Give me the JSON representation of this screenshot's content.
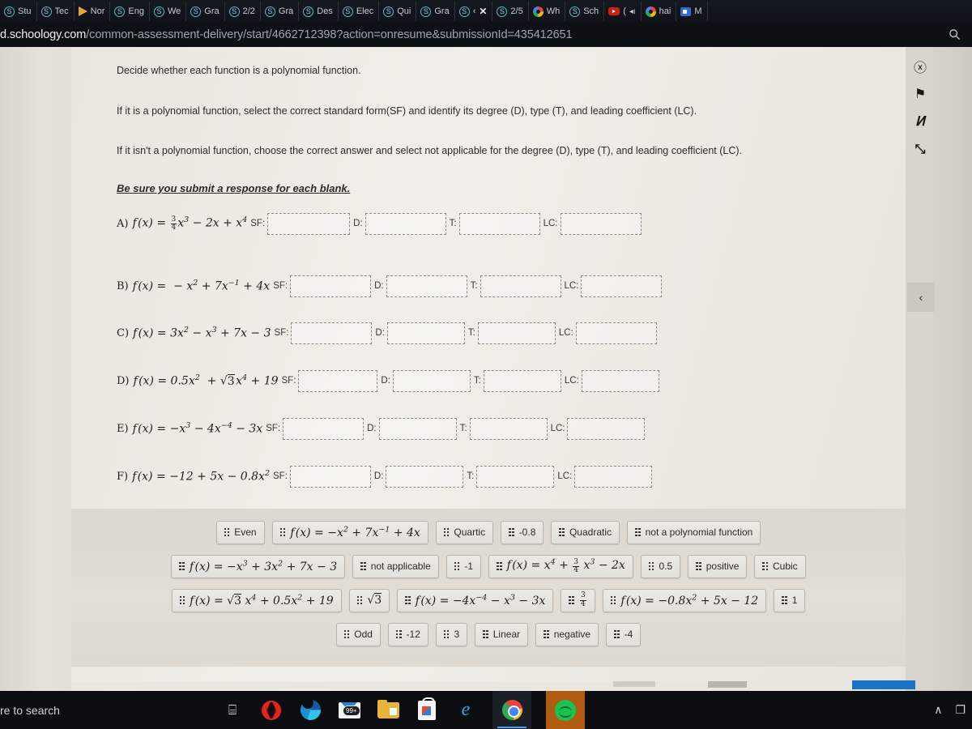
{
  "browser": {
    "tabs": [
      {
        "favicon": "favicon-generic",
        "label": "Stu"
      },
      {
        "favicon": "schoology-favicon",
        "label": "Tec"
      },
      {
        "favicon": "nearpod-favicon",
        "label": "Nor"
      },
      {
        "favicon": "schoology-favicon",
        "label": "Eng"
      },
      {
        "favicon": "schoology-favicon",
        "label": "We"
      },
      {
        "favicon": "schoology-favicon",
        "label": "Gra"
      },
      {
        "favicon": "schoology-favicon",
        "label": "2/2"
      },
      {
        "favicon": "schoology-favicon",
        "label": "Gra"
      },
      {
        "favicon": "schoology-favicon",
        "label": "Des"
      },
      {
        "favicon": "schoology-favicon",
        "label": "Elec"
      },
      {
        "favicon": "schoology-favicon",
        "label": "Qui"
      },
      {
        "favicon": "schoology-favicon",
        "label": "Gra"
      },
      {
        "favicon": "schoology-favicon",
        "label": "‹",
        "close": "✕"
      },
      {
        "favicon": "schoology-favicon",
        "label": "2/5"
      },
      {
        "favicon": "google-favicon",
        "label": "Wh"
      },
      {
        "favicon": "schoology-favicon",
        "label": "Sch"
      },
      {
        "favicon": "youtube-favicon",
        "label": "(",
        "speaker": "🔊"
      },
      {
        "favicon": "google-favicon",
        "label": "hai"
      },
      {
        "favicon": "meet-favicon",
        "label": "M"
      }
    ],
    "url_domain": "d.schoology.com",
    "url_path": "/common-assessment-delivery/start/4662712398?action=onresume&submissionId=435412651",
    "search_icon": "search-icon"
  },
  "assessment": {
    "instructions": [
      "Decide whether each function is a polynomial function.",
      "If it is a polynomial function, select the correct standard form(SF) and identify its degree (D), type (T), and leading coefficient (LC).",
      "If it isn't a polynomial function, choose the correct answer and select not applicable for the degree (D), type (T), and leading coefficient (LC).",
      "Be sure you submit a response for each blank."
    ],
    "blank_labels": {
      "sf": "SF:",
      "d": "D:",
      "t": "T:",
      "lc": "LC:"
    },
    "questions": [
      {
        "letter": "A)",
        "formula_plain": "f(x) = 3/4 x^3 - 2x + x^4",
        "sf_value": "",
        "d_value": "",
        "t_value": "",
        "lc_value": ""
      },
      {
        "letter": "B)",
        "formula_plain": "f(x) = -x^2 + 7x^-1 + 4x",
        "sf_value": "",
        "d_value": "",
        "t_value": "",
        "lc_value": ""
      },
      {
        "letter": "C)",
        "formula_plain": "f(x) = 3x^2 - x^3 + 7x - 3",
        "sf_value": "",
        "d_value": "",
        "t_value": "",
        "lc_value": ""
      },
      {
        "letter": "D)",
        "formula_plain": "f(x) = 0.5x^2 + √3 x^4 + 19",
        "sf_value": "",
        "d_value": "",
        "t_value": "",
        "lc_value": ""
      },
      {
        "letter": "E)",
        "formula_plain": "f(x) = -x^3 - 4x^-4 - 3x",
        "sf_value": "",
        "d_value": "",
        "t_value": "",
        "lc_value": ""
      },
      {
        "letter": "F)",
        "formula_plain": "f(x) = -12 + 5x - 0.8x^2",
        "sf_value": "",
        "d_value": "",
        "t_value": "",
        "lc_value": ""
      }
    ],
    "answer_bank_rows": [
      [
        {
          "type": "text",
          "label": "Even"
        },
        {
          "type": "math",
          "label": "f(x) = -x^2 + 7x^-1 + 4x"
        },
        {
          "type": "text",
          "label": "Quartic"
        },
        {
          "type": "text",
          "label": "-0.8"
        },
        {
          "type": "text",
          "label": "Quadratic"
        },
        {
          "type": "text",
          "label": "not a polynomial function"
        }
      ],
      [
        {
          "type": "math",
          "label": "f(x) = -x^3 + 3x^2 + 7x - 3"
        },
        {
          "type": "text",
          "label": "not applicable"
        },
        {
          "type": "text",
          "label": "-1"
        },
        {
          "type": "math",
          "label": "f(x) = x^4 + 3/4 x^3 - 2x"
        },
        {
          "type": "text",
          "label": "0.5"
        },
        {
          "type": "text",
          "label": "positive"
        },
        {
          "type": "text",
          "label": "Cubic"
        }
      ],
      [
        {
          "type": "math",
          "label": "f(x) = √3 x^4 + 0.5x^2 + 19"
        },
        {
          "type": "math",
          "label": "√3"
        },
        {
          "type": "math",
          "label": "f(x) = -4x^-4 - x^3 - 3x"
        },
        {
          "type": "math",
          "label": "3/4"
        },
        {
          "type": "math",
          "label": "f(x) = -0.8x^2 + 5x - 12"
        },
        {
          "type": "text",
          "label": "1"
        }
      ],
      [
        {
          "type": "text",
          "label": "Odd"
        },
        {
          "type": "text",
          "label": "-12"
        },
        {
          "type": "text",
          "label": "3"
        },
        {
          "type": "text",
          "label": "Linear"
        },
        {
          "type": "text",
          "label": "negative"
        },
        {
          "type": "text",
          "label": "-4"
        }
      ]
    ],
    "rail_icons": [
      {
        "name": "accessibility-icon",
        "glyph": "ⓧ"
      },
      {
        "name": "flag-icon",
        "glyph": "⚑"
      },
      {
        "name": "strikethrough-pencil-icon",
        "glyph": "Ͷ"
      },
      {
        "name": "expand-icon",
        "glyph": "⤡"
      }
    ],
    "rail_collapse_glyph": "‹"
  },
  "taskbar": {
    "search_text": "re to search",
    "task_view_glyph": "⌸",
    "mail_badge": "99+",
    "tray": {
      "chevron": "∧",
      "device": "❐"
    }
  },
  "colors": {
    "accent_blue": "#1a73c8",
    "paper": "#eae7e0",
    "bank_bg": "#ded9d1",
    "tile_border": "#b9b5ad",
    "blank_dash": "#8e8a82"
  }
}
